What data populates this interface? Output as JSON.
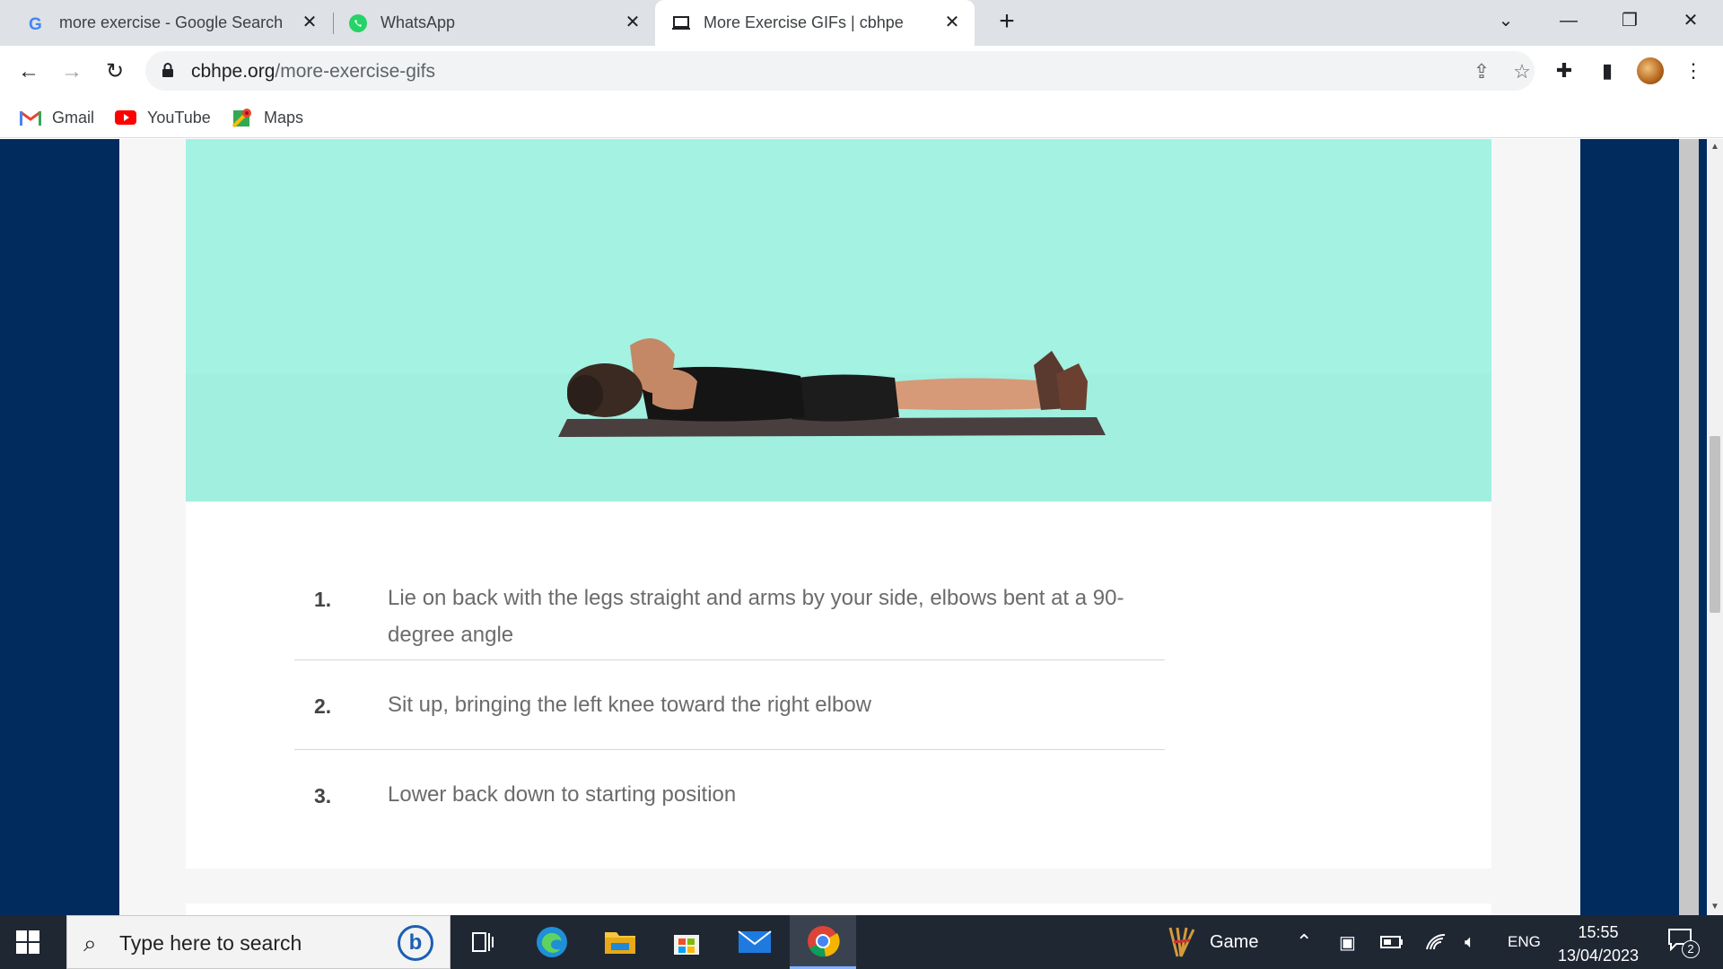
{
  "browser": {
    "tabs": [
      {
        "title": "more exercise - Google Search",
        "icon": "google-icon"
      },
      {
        "title": "WhatsApp",
        "icon": "whatsapp-icon"
      },
      {
        "title": "More Exercise GIFs | cbhpe",
        "icon": "laptop-icon",
        "active": true
      }
    ],
    "new_tab": "+",
    "url_domain": "cbhpe.org",
    "url_path": "/more-exercise-gifs",
    "bookmarks": [
      {
        "label": "Gmail",
        "icon": "gmail-icon"
      },
      {
        "label": "YouTube",
        "icon": "youtube-icon"
      },
      {
        "label": "Maps",
        "icon": "maps-icon"
      }
    ]
  },
  "page": {
    "hero_image": "man-lying-on-mat-exercise-gif",
    "steps": [
      {
        "num": "1.",
        "text": "Lie on back with the legs straight and arms by your side, elbows bent at a 90-degree angle"
      },
      {
        "num": "2.",
        "text": "Sit up, bringing the left knee toward the right elbow"
      },
      {
        "num": "3.",
        "text": "Lower back down to starting position"
      }
    ],
    "colors": {
      "background": "#012b5c",
      "hero": "#a3f2e2",
      "card": "#ffffff"
    }
  },
  "taskbar": {
    "search_placeholder": "Type here to search",
    "game_label": "Game",
    "language": "ENG",
    "time": "15:55",
    "date": "13/04/2023",
    "notification_count": "2"
  }
}
